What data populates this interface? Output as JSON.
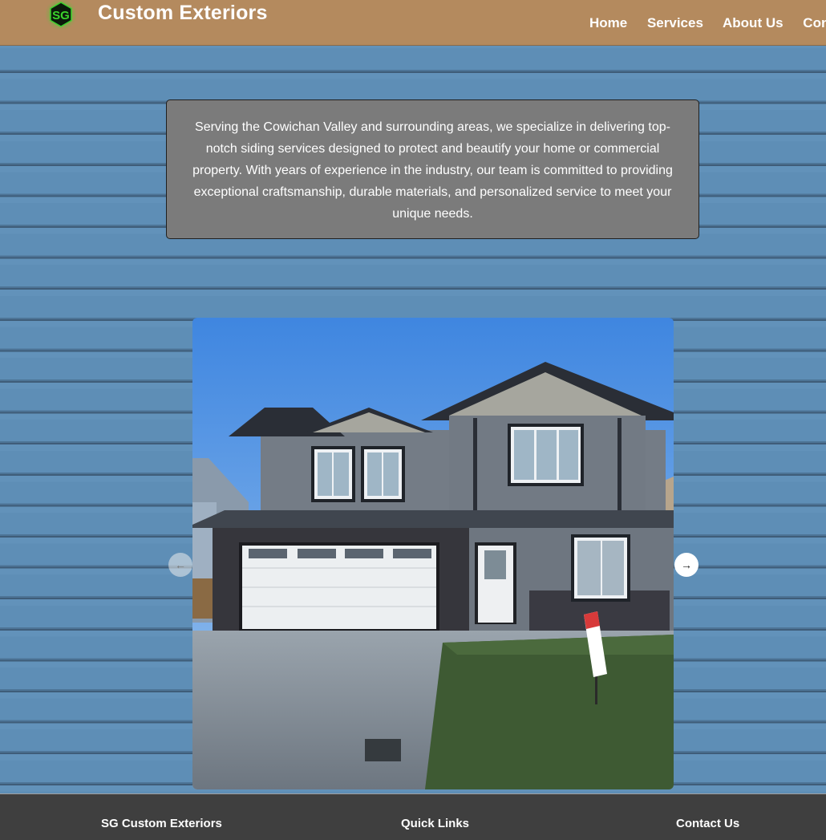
{
  "header": {
    "logo_text": "SG",
    "brand": "Custom Exteriors",
    "nav": [
      "Home",
      "Services",
      "About Us",
      "Contact"
    ]
  },
  "intro": {
    "text": "Serving the Cowichan Valley and surrounding areas, we specialize in delivering top-notch siding services designed to protect and beautify your home or commercial property. With years of experience in the industry, our team is committed to providing exceptional craftsmanship, durable materials, and personalized service to meet your unique needs."
  },
  "carousel": {
    "prev_icon": "arrow-left-icon",
    "next_icon": "arrow-right-icon",
    "prev_glyph": "←",
    "next_glyph": "→"
  },
  "footer": {
    "company": "SG Custom Exteriors",
    "quick_links": "Quick Links",
    "contact": "Contact Us"
  },
  "colors": {
    "header_bg": "#b48a5e",
    "siding_blue": "#5e8db4",
    "intro_box": "#7b7b7b",
    "footer_bg": "#3f3f3f",
    "logo_green": "#3bd32c"
  }
}
